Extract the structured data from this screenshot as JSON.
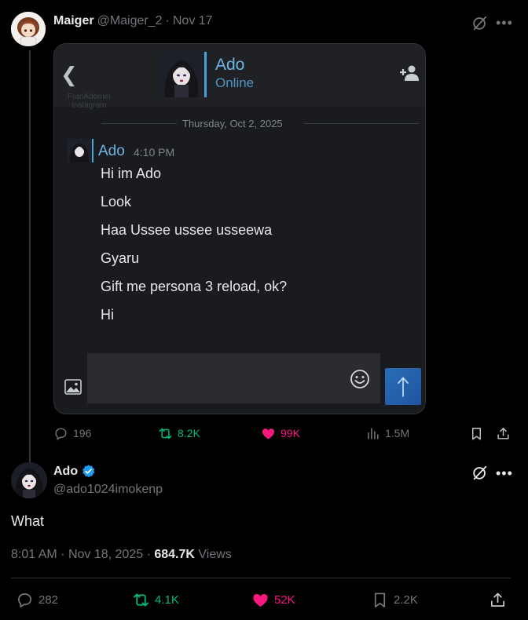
{
  "parent_tweet": {
    "author_name": "Maiger",
    "author_handle": "@Maiger_2",
    "separator": "·",
    "date": "Nov 17",
    "embedded_image": {
      "contact_name": "Ado",
      "contact_status": "Online",
      "watermark_line1": "FranAdomin",
      "watermark_line2": "Instagram",
      "date_separator": "Thursday, Oct 2, 2025",
      "sender": "Ado",
      "time": "4:10 PM",
      "messages": [
        "Hi im Ado",
        "Look",
        "Haa Ussee ussee usseewa",
        "Gyaru",
        "Gift me persona 3 reload, ok?",
        "Hi"
      ]
    },
    "stats": {
      "replies": "196",
      "reposts": "8.2K",
      "likes": "99K",
      "views": "1.5M"
    }
  },
  "main_tweet": {
    "author_name": "Ado",
    "author_handle": "@ado1024imokenp",
    "text": "What",
    "time": "8:01 AM",
    "date": "Nov 18, 2025",
    "separator": "·",
    "views_count": "684.7K",
    "views_label": "Views",
    "stats": {
      "replies": "282",
      "reposts": "4.1K",
      "likes": "52K",
      "bookmarks": "2.2K"
    }
  },
  "colors": {
    "background": "#000000",
    "text_primary": "#e7e9ea",
    "text_secondary": "#71767b",
    "repost_green": "#00ba7c",
    "like_pink": "#f91880",
    "verified_blue": "#1d9bf0"
  },
  "icons": [
    "grok-icon",
    "more-icon",
    "reply-icon",
    "repost-icon",
    "like-icon",
    "views-icon",
    "bookmark-icon",
    "share-icon",
    "verified-icon",
    "back-arrow-icon",
    "add-friend-icon",
    "image-icon",
    "emoji-icon",
    "send-arrow-icon"
  ]
}
